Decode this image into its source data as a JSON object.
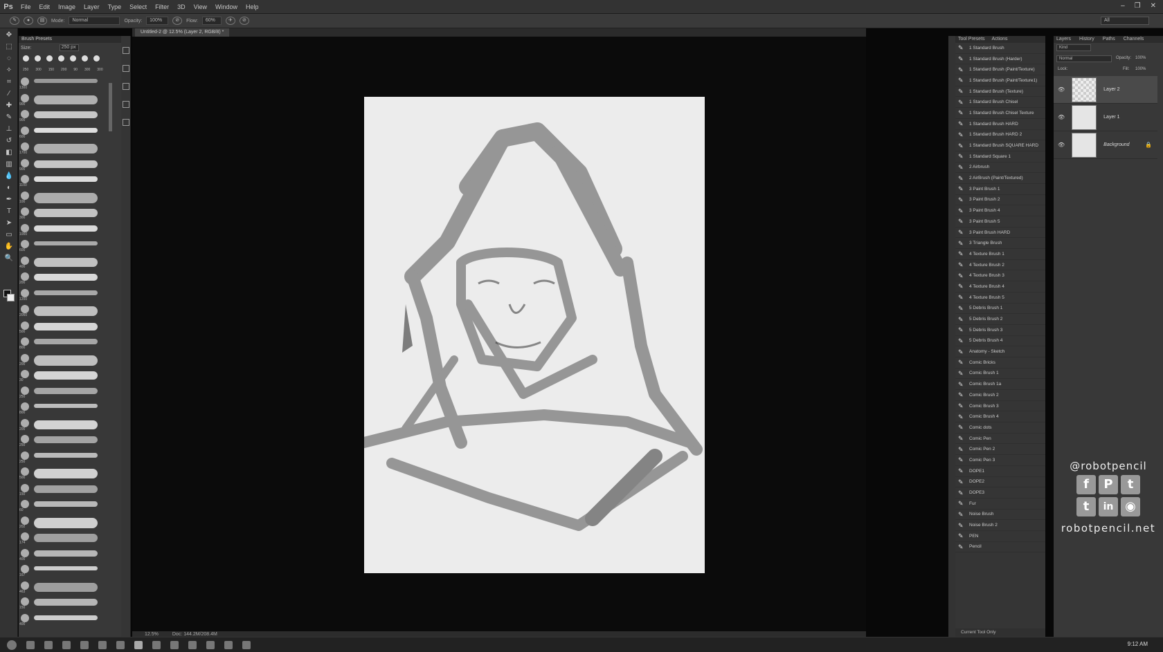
{
  "app": {
    "logo": "Ps"
  },
  "menu": [
    "File",
    "Edit",
    "Image",
    "Layer",
    "Type",
    "Select",
    "Filter",
    "3D",
    "View",
    "Window",
    "Help"
  ],
  "options": {
    "mode_label": "Mode:",
    "mode": "Normal",
    "opacity_label": "Opacity:",
    "opacity": "100%",
    "flow_label": "Flow:",
    "flow": "60%",
    "workspace": "All"
  },
  "brush_panel": {
    "title": "Brush Presets",
    "size_label": "Size:",
    "size": "250 px",
    "dot_sizes": [
      "250",
      "300",
      "150",
      "200",
      "90",
      "300",
      "300"
    ],
    "side_numbers": [
      "1300",
      "900",
      "900",
      "600",
      "1700",
      "900",
      "1100",
      "100",
      "300",
      "1000",
      "600",
      "400",
      "200",
      "1200",
      "2050",
      "500",
      "800",
      "200",
      "30",
      "250",
      "800",
      "200",
      "250",
      "250",
      "500",
      "150",
      "60",
      "202",
      "174",
      "400",
      "167",
      "463",
      "150",
      "400"
    ]
  },
  "document": {
    "tab": "Untitled-2 @ 12.5% (Layer 2, RGB/8) *",
    "zoom": "12.5%",
    "doc": "Doc: 144.2M/208.4M"
  },
  "presets_panel": {
    "tabs": [
      "Tool Presets",
      "Actions"
    ],
    "items": [
      "1 Standard Brush",
      "1 Standard Brush (Harder)",
      "1 Standard Brush (Paint/Texture)",
      "1 Standard Brush (Paint/Texture1)",
      "1 Standard Brush (Texture)",
      "1 Standard Brush Chisel",
      "1 Standard Brush Chisel Texture",
      "1 Standard Brush HARD",
      "1 Standard Brush HARD 2",
      "1 Standard Brush SQUARE HARD",
      "1 Standard Square 1",
      "2 Airbrush",
      "2 AirBrush (Paint/Textured)",
      "3 Paint Brush 1",
      "3 Paint Brush 2",
      "3 Paint Brush 4",
      "3 Paint Brush 5",
      "3 Paint Brush HARD",
      "3 Triangle Brush",
      "4 Texture Brush 1",
      "4 Texture Brush 2",
      "4 Texture Brush 3",
      "4 Texture Brush 4",
      "4 Texture Brush 5",
      "5 Debris Brush 1",
      "5 Debris Brush 2",
      "5 Debris Brush 3",
      "5 Debris Brush 4",
      "Anatomy - Sketch",
      "Comic Bricks",
      "Comic Brush 1",
      "Comic Brush 1a",
      "Comic Brush 2",
      "Comic Brush 3",
      "Comic Brush 4",
      "Comic dots",
      "Comic Pen",
      "Comic Pen 2",
      "Comic Pen 3",
      "DOPE1",
      "DOPE2",
      "DOPE3",
      "Fur",
      "Noise Brush",
      "Noise Brush 2",
      "PEN",
      "Pencil"
    ],
    "footer": "Current Tool Only"
  },
  "layers_panel": {
    "tabs": [
      "Layers",
      "History",
      "Paths",
      "Channels"
    ],
    "filter": "Kind",
    "blend": "Normal",
    "opacity_label": "Opacity:",
    "opacity": "100%",
    "lock_label": "Lock:",
    "fill_label": "Fill:",
    "fill": "100%",
    "layers": [
      {
        "name": "Layer 2"
      },
      {
        "name": "Layer 1"
      },
      {
        "name": "Background"
      }
    ]
  },
  "social": {
    "handle": "@robotpencil",
    "site": "robotpencil.net",
    "icons": [
      "facebook-icon",
      "pinterest-icon",
      "twitter-icon",
      "tumblr-icon",
      "linkedin-icon",
      "instagram-icon"
    ],
    "glyphs": [
      "f",
      "P",
      "t",
      "t",
      "in",
      "◉"
    ]
  },
  "taskbar": {
    "time": "9:12 AM"
  }
}
